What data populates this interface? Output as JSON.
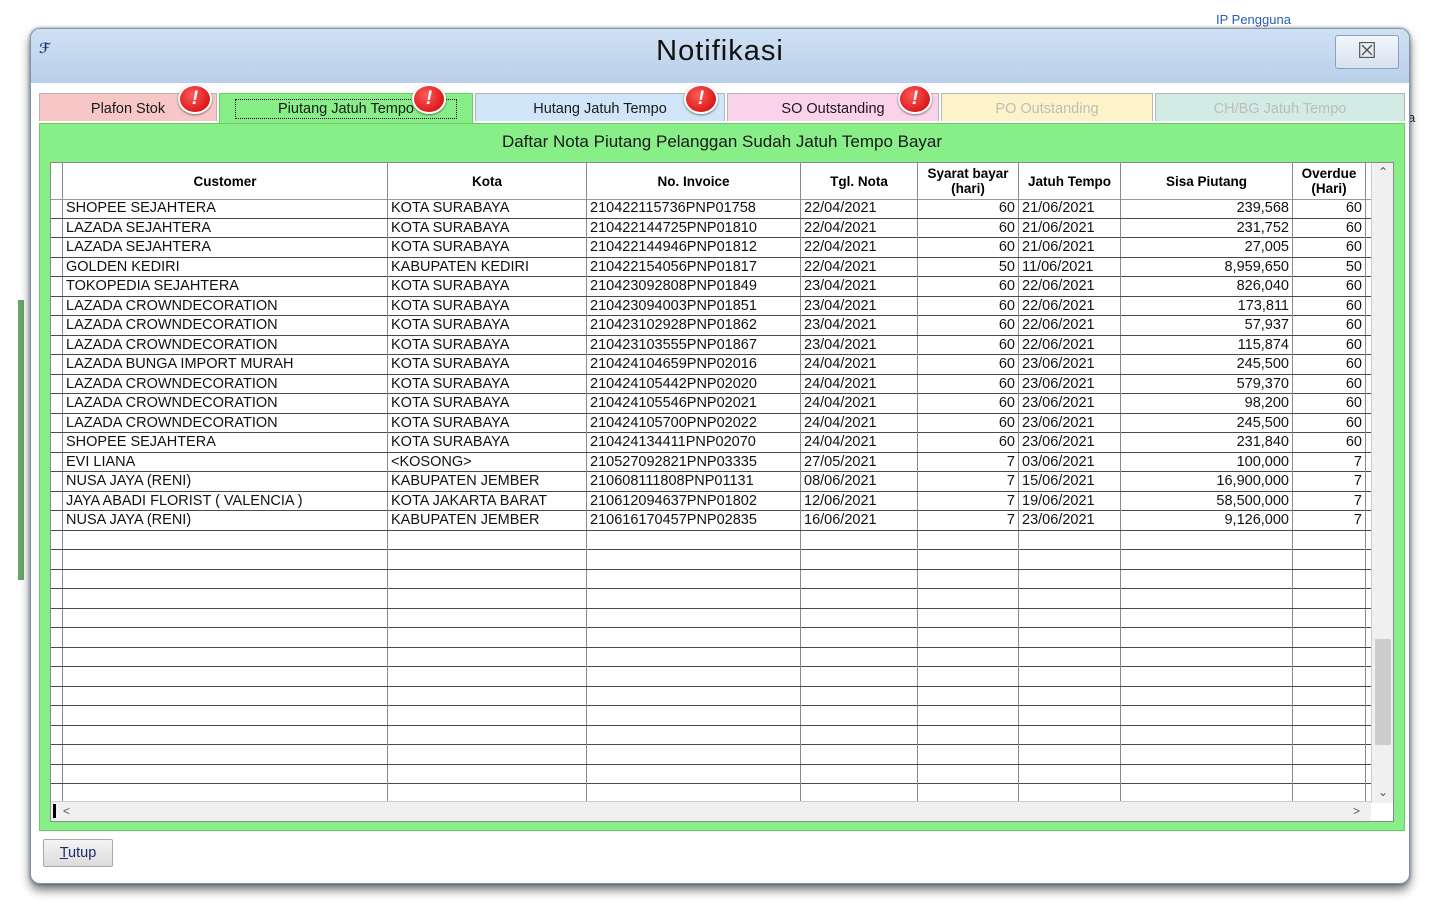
{
  "background": {
    "top_label": "IP Pengguna",
    "right_letter": "a"
  },
  "window": {
    "title": "Notifikasi",
    "close_symbol": "☒"
  },
  "tabs": [
    {
      "label": "Plafon Stok",
      "color": "#f7c7c7",
      "badge": "!",
      "active": false,
      "dimmed": false
    },
    {
      "label": "Piutang Jatuh Tempo",
      "color": "#88ee88",
      "badge": "!",
      "active": true,
      "dimmed": false
    },
    {
      "label": "Hutang Jatuh Tempo",
      "color": "#d0e6f8",
      "badge": "!",
      "active": false,
      "dimmed": false
    },
    {
      "label": "SO Outstanding",
      "color": "#fad2ea",
      "badge": "!",
      "active": false,
      "dimmed": false
    },
    {
      "label": "PO Outstanding",
      "color": "#fcf3c9",
      "badge": "",
      "active": false,
      "dimmed": true
    },
    {
      "label": "CH/BG Jatuh Tempo",
      "color": "#d2ebe4",
      "badge": "",
      "active": false,
      "dimmed": true
    }
  ],
  "panel": {
    "title": "Daftar Nota Piutang Pelanggan Sudah Jatuh Tempo Bayar"
  },
  "table": {
    "columns": [
      "Customer",
      "Kota",
      "No. Invoice",
      "Tgl. Nota",
      "Syarat bayar\n(hari)",
      "Jatuh Tempo",
      "Sisa Piutang",
      "Overdue\n(Hari)"
    ],
    "rows": [
      [
        "SHOPEE SEJAHTERA",
        "KOTA SURABAYA",
        "210422115736PNP01758",
        "22/04/2021",
        "60",
        "21/06/2021",
        "239,568",
        "60"
      ],
      [
        "LAZADA SEJAHTERA",
        "KOTA SURABAYA",
        "210422144725PNP01810",
        "22/04/2021",
        "60",
        "21/06/2021",
        "231,752",
        "60"
      ],
      [
        "LAZADA SEJAHTERA",
        "KOTA SURABAYA",
        "210422144946PNP01812",
        "22/04/2021",
        "60",
        "21/06/2021",
        "27,005",
        "60"
      ],
      [
        "GOLDEN KEDIRI",
        "KABUPATEN KEDIRI",
        "210422154056PNP01817",
        "22/04/2021",
        "50",
        "11/06/2021",
        "8,959,650",
        "50"
      ],
      [
        "TOKOPEDIA SEJAHTERA",
        "KOTA SURABAYA",
        "210423092808PNP01849",
        "23/04/2021",
        "60",
        "22/06/2021",
        "826,040",
        "60"
      ],
      [
        "LAZADA CROWNDECORATION",
        "KOTA SURABAYA",
        "210423094003PNP01851",
        "23/04/2021",
        "60",
        "22/06/2021",
        "173,811",
        "60"
      ],
      [
        "LAZADA CROWNDECORATION",
        "KOTA SURABAYA",
        "210423102928PNP01862",
        "23/04/2021",
        "60",
        "22/06/2021",
        "57,937",
        "60"
      ],
      [
        "LAZADA CROWNDECORATION",
        "KOTA SURABAYA",
        "210423103555PNP01867",
        "23/04/2021",
        "60",
        "22/06/2021",
        "115,874",
        "60"
      ],
      [
        "LAZADA BUNGA IMPORT MURAH",
        "KOTA SURABAYA",
        "210424104659PNP02016",
        "24/04/2021",
        "60",
        "23/06/2021",
        "245,500",
        "60"
      ],
      [
        "LAZADA CROWNDECORATION",
        "KOTA SURABAYA",
        "210424105442PNP02020",
        "24/04/2021",
        "60",
        "23/06/2021",
        "579,370",
        "60"
      ],
      [
        "LAZADA CROWNDECORATION",
        "KOTA SURABAYA",
        "210424105546PNP02021",
        "24/04/2021",
        "60",
        "23/06/2021",
        "98,200",
        "60"
      ],
      [
        "LAZADA CROWNDECORATION",
        "KOTA SURABAYA",
        "210424105700PNP02022",
        "24/04/2021",
        "60",
        "23/06/2021",
        "245,500",
        "60"
      ],
      [
        "SHOPEE SEJAHTERA",
        "KOTA SURABAYA",
        "210424134411PNP02070",
        "24/04/2021",
        "60",
        "23/06/2021",
        "231,840",
        "60"
      ],
      [
        "EVI LIANA",
        "<KOSONG>",
        "210527092821PNP03335",
        "27/05/2021",
        "7",
        "03/06/2021",
        "100,000",
        "7"
      ],
      [
        "NUSA JAYA (RENI)",
        "KABUPATEN JEMBER",
        "210608111808PNP01131",
        "08/06/2021",
        "7",
        "15/06/2021",
        "16,900,000",
        "7"
      ],
      [
        "JAYA ABADI FLORIST ( VALENCIA )",
        "KOTA JAKARTA BARAT",
        "210612094637PNP01802",
        "12/06/2021",
        "7",
        "19/06/2021",
        "58,500,000",
        "7"
      ],
      [
        "NUSA JAYA (RENI)",
        "KABUPATEN JEMBER",
        "210616170457PNP02835",
        "16/06/2021",
        "7",
        "23/06/2021",
        "9,126,000",
        "7"
      ]
    ]
  },
  "scroll": {
    "up": "⌃",
    "down": "⌄",
    "left": "<",
    "right": ">"
  },
  "footer": {
    "close_button_underline": "T",
    "close_button_rest": "utup"
  }
}
